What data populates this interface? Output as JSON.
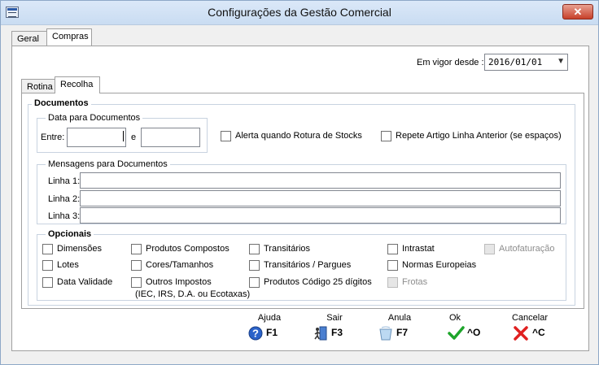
{
  "window": {
    "title": "Configurações da Gestão Comercial",
    "close_symbol": "✕"
  },
  "tabs_main": [
    "Geral",
    "Compras"
  ],
  "em_vigor": {
    "label": "Em vigor desde :",
    "value": "2016/01/01"
  },
  "tabs_sub": [
    "Rotina",
    "Recolha"
  ],
  "documentos": {
    "title": "Documentos",
    "data_title": "Data para Documentos",
    "entre_label": "Entre:",
    "e_label": "e",
    "entre_value": "",
    "e_value": "",
    "alerta_label": "Alerta quando Rotura de Stocks",
    "repete_label": "Repete Artigo Linha Anterior (se espaços)"
  },
  "mensagens": {
    "title": "Mensagens para Documentos",
    "lines": [
      {
        "label": "Linha 1:",
        "value": ""
      },
      {
        "label": "Linha 2:",
        "value": ""
      },
      {
        "label": "Linha 3:",
        "value": ""
      }
    ]
  },
  "opcionais": {
    "title": "Opcionais",
    "items": [
      {
        "label": "Dimensões",
        "checked": false,
        "enabled": true
      },
      {
        "label": "Lotes",
        "checked": false,
        "enabled": true
      },
      {
        "label": "Data Validade",
        "checked": false,
        "enabled": true
      },
      {
        "label": "Produtos Compostos",
        "checked": false,
        "enabled": true
      },
      {
        "label": "Cores/Tamanhos",
        "checked": false,
        "enabled": true
      },
      {
        "label": "Outros Impostos",
        "checked": false,
        "enabled": true
      },
      {
        "label": "Transitários",
        "checked": false,
        "enabled": true
      },
      {
        "label": "Transitários / Pargues",
        "checked": false,
        "enabled": true
      },
      {
        "label": "Produtos Código 25 dígitos",
        "checked": false,
        "enabled": true
      },
      {
        "label": "Intrastat",
        "checked": false,
        "enabled": true
      },
      {
        "label": "Normas Europeias",
        "checked": false,
        "enabled": true
      },
      {
        "label": "Frotas",
        "checked": false,
        "enabled": false
      },
      {
        "label": "Autofaturação",
        "checked": false,
        "enabled": false
      }
    ],
    "outros_note": "(IEC, IRS, D.A. ou Ecotaxas)"
  },
  "buttons": [
    {
      "caption": "Ajuda",
      "key": "F1",
      "icon": "help-icon"
    },
    {
      "caption": "Sair",
      "key": "F3",
      "icon": "exit-door-icon"
    },
    {
      "caption": "Anula",
      "key": "F7",
      "icon": "cancel-glass-icon"
    },
    {
      "caption": "Ok",
      "key": "^O",
      "icon": "check-icon"
    },
    {
      "caption": "Cancelar",
      "key": "^C",
      "icon": "red-x-icon"
    }
  ],
  "colors": {
    "check_green": "#1ea52b",
    "cancel_red": "#e02020",
    "help_blue": "#2a62c9"
  }
}
